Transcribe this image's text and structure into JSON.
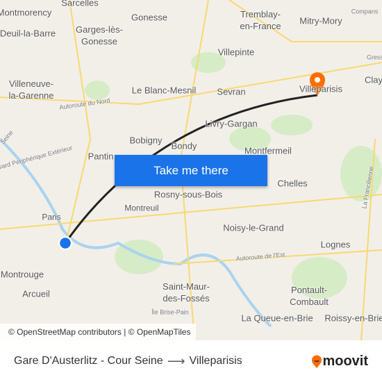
{
  "map": {
    "places": [
      "Sarcelles",
      "Montmorency",
      "Gonesse",
      "Garges-lès-\nGonesse",
      "Deuil-la-Barre",
      "Tremblay-\nen-France",
      "Mitry-Mory",
      "Villepinte",
      "Villeneuve-\nla-Garenne",
      "Le Blanc-Mesnil",
      "Sevran",
      "Villeparisis",
      "Livry-Gargan",
      "Bobigny",
      "Bondy",
      "Montfermeil",
      "Pantin",
      "Chelles",
      "Rosny-sous-Bois",
      "Montreuil",
      "Paris",
      "Noisy-le-Grand",
      "Lognes",
      "Montrouge",
      "Arcueil",
      "Saint-Maur-\ndes-Fossés",
      "Pontault-\nCombault",
      "La Queue-en-Brie",
      "Roissy-en-Brie",
      "Clay"
    ],
    "minor_labels": [
      "Autoroute du Nord",
      "Autoroute de l'Est",
      "Compans",
      "Gress",
      "La Francilienne",
      "Île Brise-Pain",
      "Boulevard Périphérique Extérieur",
      "Seine"
    ],
    "route_color": "#222222",
    "origin_color": "#1a73e8",
    "destination_color": "#ff6d00"
  },
  "cta": {
    "label": "Take me there"
  },
  "attribution": "© OpenStreetMap contributors | © OpenMapTiles",
  "footer": {
    "origin": "Gare D'Austerlitz - Cour Seine",
    "arrow": "⟶",
    "destination": "Villeparisis",
    "brand": "moovit"
  }
}
